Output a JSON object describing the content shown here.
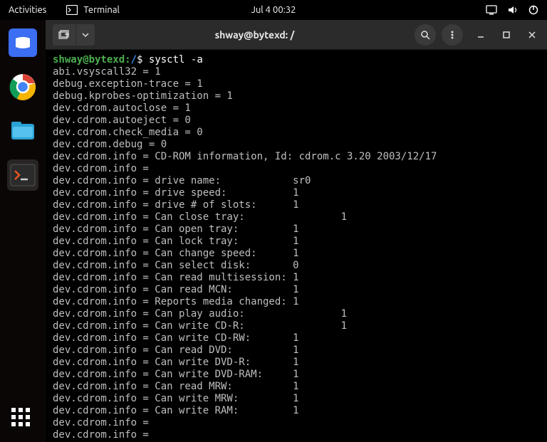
{
  "topbar": {
    "activities": "Activities",
    "app_name": "Terminal",
    "datetime": "Jul 4  00:32"
  },
  "dock": {
    "items": [
      "ubuntu-software",
      "chrome",
      "files",
      "terminal"
    ]
  },
  "window": {
    "title": "shway@bytexd: /"
  },
  "terminal": {
    "prompt_user": "shway@bytexd",
    "prompt_sep": ":",
    "prompt_path": "/",
    "prompt_symbol": "$",
    "command": " sysctl -a",
    "lines": [
      "abi.vsyscall32 = 1",
      "debug.exception-trace = 1",
      "debug.kprobes-optimization = 1",
      "dev.cdrom.autoclose = 1",
      "dev.cdrom.autoeject = 0",
      "dev.cdrom.check_media = 0",
      "dev.cdrom.debug = 0",
      "dev.cdrom.info = CD-ROM information, Id: cdrom.c 3.20 2003/12/17",
      "dev.cdrom.info =",
      "dev.cdrom.info = drive name:            sr0",
      "dev.cdrom.info = drive speed:           1",
      "dev.cdrom.info = drive # of slots:      1",
      "dev.cdrom.info = Can close tray:                1",
      "dev.cdrom.info = Can open tray:         1",
      "dev.cdrom.info = Can lock tray:         1",
      "dev.cdrom.info = Can change speed:      1",
      "dev.cdrom.info = Can select disk:       0",
      "dev.cdrom.info = Can read multisession: 1",
      "dev.cdrom.info = Can read MCN:          1",
      "dev.cdrom.info = Reports media changed: 1",
      "dev.cdrom.info = Can play audio:                1",
      "dev.cdrom.info = Can write CD-R:                1",
      "dev.cdrom.info = Can write CD-RW:       1",
      "dev.cdrom.info = Can read DVD:          1",
      "dev.cdrom.info = Can write DVD-R:       1",
      "dev.cdrom.info = Can write DVD-RAM:     1",
      "dev.cdrom.info = Can read MRW:          1",
      "dev.cdrom.info = Can write MRW:         1",
      "dev.cdrom.info = Can write RAM:         1",
      "dev.cdrom.info =",
      "dev.cdrom.info ="
    ]
  }
}
